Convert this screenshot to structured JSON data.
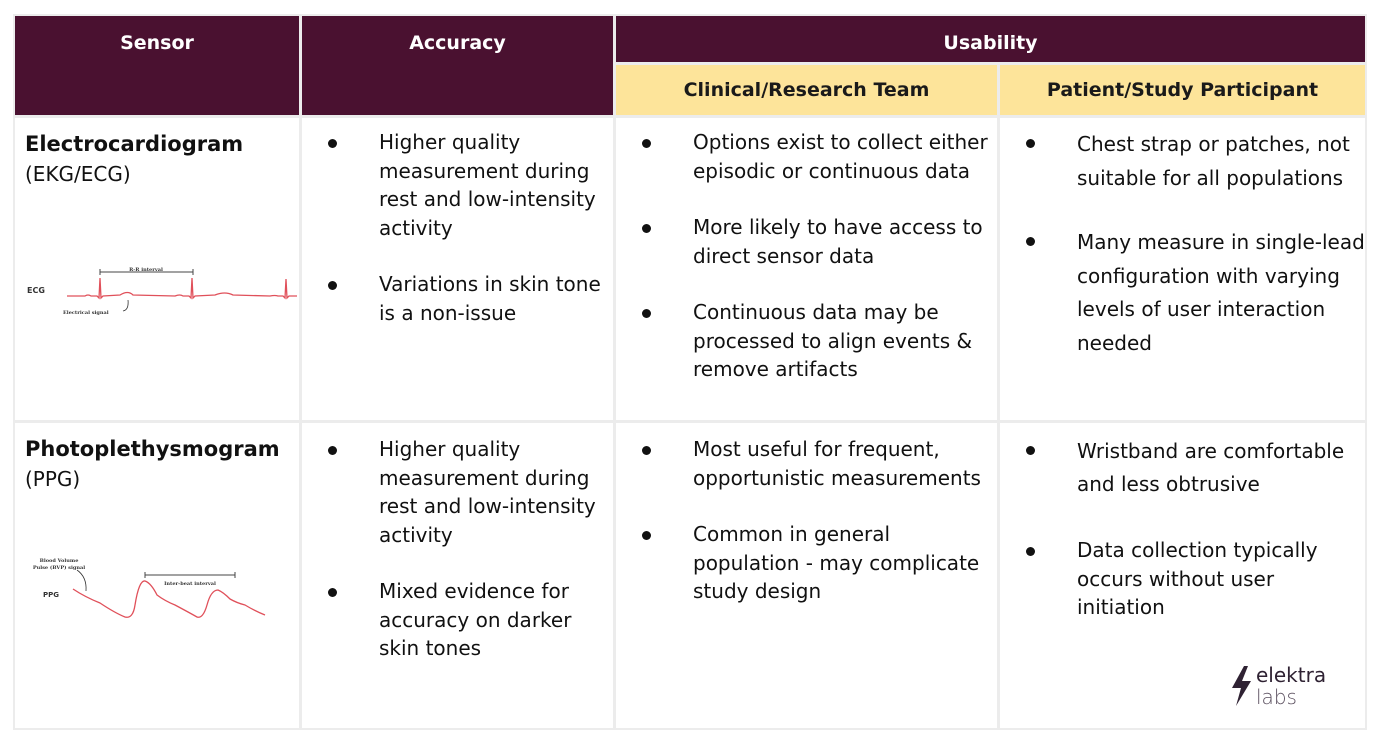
{
  "header": {
    "sensor": "Sensor",
    "accuracy": "Accuracy",
    "usability": "Usability",
    "clinical": "Clinical/Research Team",
    "patient": "Patient/Study Participant"
  },
  "rows": [
    {
      "name": "Electrocardiogram",
      "abbr": "(EKG/ECG)",
      "figure": {
        "label": "ECG",
        "interval_label": "R-R interval",
        "signal_label": "Electrical signal"
      },
      "accuracy": [
        "Higher quality measurement during rest and low-intensity activity",
        "Variations in skin tone is a non-issue"
      ],
      "clinical": [
        "Options exist to collect either episodic or continuous data",
        "More likely to have access to direct sensor data",
        "Continuous data may be processed to align events & remove artifacts"
      ],
      "patient": [
        "Chest strap or patches, not suitable for all populations",
        "Many measure in single-lead configuration with varying levels of user interaction needed"
      ]
    },
    {
      "name": "Photoplethysmogram",
      "abbr": "(PPG)",
      "figure": {
        "label": "PPG",
        "interval_label": "Inter-beat interval",
        "signal_label_1": "Blood Volume",
        "signal_label_2": "Pulse (BVP) signal"
      },
      "accuracy": [
        "Higher quality measurement during rest and low-intensity activity",
        "Mixed evidence for accuracy on darker skin tones"
      ],
      "clinical": [
        "Most useful for frequent, opportunistic measurements",
        "Common in general population - may complicate study design"
      ],
      "patient": [
        "Wristband are comfortable and less obtrusive",
        "Data collection typically occurs without user initiation"
      ]
    }
  ],
  "logo": {
    "line1": "elektra",
    "line2": "labs"
  },
  "colors": {
    "header_bg": "#4a1130",
    "subheader_bg": "#fde49a",
    "wave": "#e0505a"
  }
}
